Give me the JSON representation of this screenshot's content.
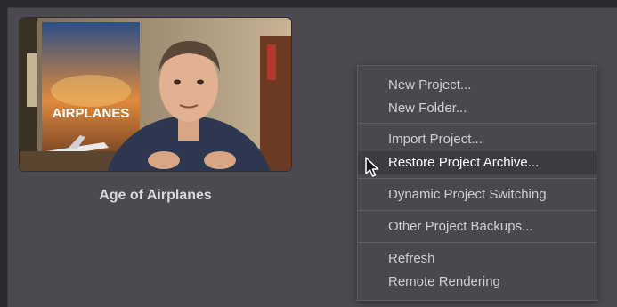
{
  "project": {
    "name": "Age of Airplanes",
    "thumbnail_poster_text": "AIRPLANES"
  },
  "context_menu": {
    "items": [
      {
        "label": "New Project..."
      },
      {
        "label": "New Folder..."
      },
      {
        "label": "Import Project..."
      },
      {
        "label": "Restore Project Archive...",
        "highlighted": true
      },
      {
        "label": "Dynamic Project Switching"
      },
      {
        "label": "Other Project Backups..."
      },
      {
        "label": "Refresh"
      },
      {
        "label": "Remote Rendering"
      }
    ]
  },
  "colors": {
    "panel_bg": "#4a4a50",
    "menu_bg": "#48484d",
    "menu_highlight": "#3b3b40"
  }
}
